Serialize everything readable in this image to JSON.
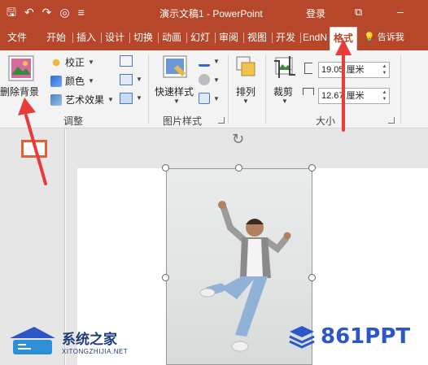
{
  "titlebar": {
    "title": "演示文稿1 - PowerPoint",
    "login_label": "登录",
    "colors": {
      "brand": "#b7472a"
    },
    "icons": [
      "save-icon",
      "undo-icon",
      "redo-icon",
      "start-slideshow-icon",
      "customize-qat-icon",
      "ribbon-display-options-icon",
      "minimize-icon"
    ]
  },
  "tabs": [
    {
      "label": "文件"
    },
    {
      "label": "开始"
    },
    {
      "label": "插入"
    },
    {
      "label": "设计"
    },
    {
      "label": "切换"
    },
    {
      "label": "动画"
    },
    {
      "label": "幻灯"
    },
    {
      "label": "审阅"
    },
    {
      "label": "视图"
    },
    {
      "label": "开发"
    },
    {
      "label": "EndN"
    },
    {
      "label": "格式",
      "active": true
    }
  ],
  "tell_me": "告诉我",
  "ribbon": {
    "adjust_group": {
      "label": "调整",
      "remove_bg_label": "删除背景",
      "corrections_label": "校正",
      "color_label": "颜色",
      "artistic_label": "艺术效果"
    },
    "picture_styles_group": {
      "label": "图片样式",
      "quick_styles_label": "快速样式"
    },
    "arrange_group": {
      "arrange_label": "排列"
    },
    "size_group": {
      "label": "大小",
      "crop_label": "裁剪",
      "height_value": "19.05 厘米",
      "width_value": "12.67 厘米"
    }
  },
  "watermarks": {
    "left_title": "系统之家",
    "left_sub": "XITONGZHIJIA.NET",
    "right_brand": "861PPT"
  }
}
